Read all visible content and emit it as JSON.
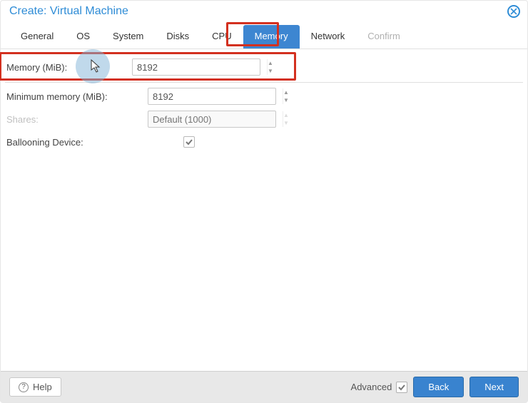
{
  "dialog": {
    "title": "Create: Virtual Machine"
  },
  "tabs": {
    "general": "General",
    "os": "OS",
    "system": "System",
    "disks": "Disks",
    "cpu": "CPU",
    "memory": "Memory",
    "network": "Network",
    "confirm": "Confirm"
  },
  "memory_form": {
    "memory_label": "Memory (MiB):",
    "memory_value": "8192",
    "min_memory_label": "Minimum memory (MiB):",
    "min_memory_value": "8192",
    "shares_label": "Shares:",
    "shares_placeholder": "Default (1000)",
    "ballooning_label": "Ballooning Device:"
  },
  "footer": {
    "help": "Help",
    "advanced": "Advanced",
    "back": "Back",
    "next": "Next"
  }
}
